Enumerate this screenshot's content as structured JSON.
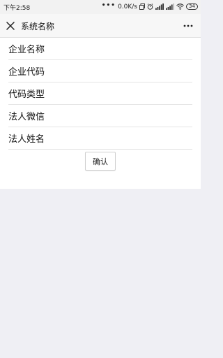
{
  "status_bar": {
    "time": "下午2:58",
    "net_speed": "0.0K/s",
    "battery": "34"
  },
  "nav": {
    "title": "系统名称",
    "close_icon": "close-icon",
    "more_icon": "more-icon"
  },
  "form": {
    "fields": [
      {
        "label": "企业名称"
      },
      {
        "label": "企业代码"
      },
      {
        "label": "代码类型"
      },
      {
        "label": "法人微信"
      },
      {
        "label": "法人姓名"
      }
    ],
    "confirm_label": "确认"
  },
  "colors": {
    "page_bg": "#efeff4",
    "nav_bg": "#f7f7f7",
    "divider": "#e5e5e5"
  }
}
